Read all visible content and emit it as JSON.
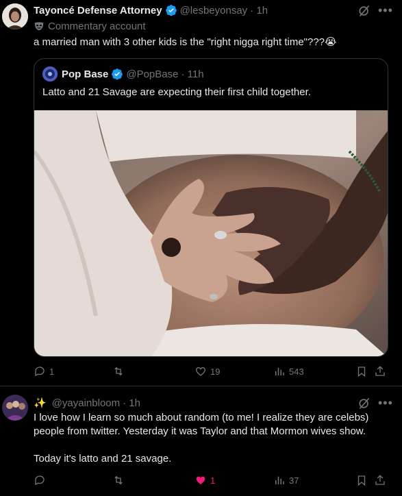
{
  "tweet1": {
    "name": "Tayoncé Defense Attorney",
    "handle": "@lesbeyonsay",
    "time": "· 1h",
    "label": "Commentary account",
    "text": "a married man with 3 other kids is the \"right nigga right time\"???😭",
    "quote": {
      "name": "Pop Base",
      "handle": "@PopBase",
      "time": "· 11h",
      "text": "Latto and 21 Savage are expecting their first child together."
    },
    "actions": {
      "replies": "1",
      "retweets": "",
      "likes": "19",
      "views": "543"
    }
  },
  "tweet2": {
    "emoji": "✨",
    "handle": "@yayainbloom",
    "time": "· 1h",
    "text1": "I love how I learn so much about random (to me! I realize they are celebs) people from twitter. Yesterday it was Taylor and that Mormon wives show.",
    "text2": "Today it's latto and 21 savage.",
    "actions": {
      "replies": "",
      "retweets": "",
      "likes": "1",
      "views": "37"
    }
  },
  "colors": {
    "verified": "#1d9bf0",
    "like_active": "#f91880",
    "muted": "#71767b"
  }
}
